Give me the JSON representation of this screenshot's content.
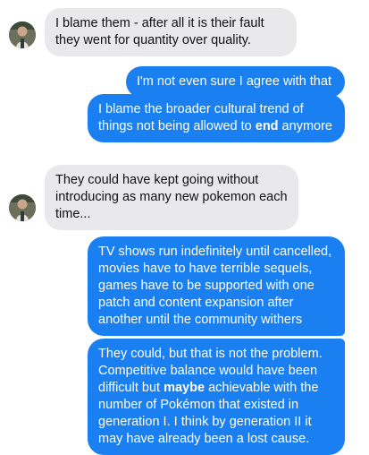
{
  "colors": {
    "incoming_bubble": "#e9e9eb",
    "outgoing_bubble": "#1a7ff0",
    "outgoing_text": "#ffffff",
    "incoming_text": "#111111"
  },
  "messages": [
    {
      "direction": "incoming",
      "avatar": "user-avatar-icon",
      "parts": [
        "I blame them - after all it is their fault they went for quantity over quality."
      ]
    },
    {
      "direction": "outgoing",
      "parts": [
        "I'm not even sure I agree with that"
      ]
    },
    {
      "direction": "outgoing",
      "parts": [
        "I blame the broader cultural trend of things not being allowed to ",
        "end",
        " anymore"
      ]
    },
    {
      "direction": "incoming",
      "avatar": "user-avatar-icon",
      "parts": [
        "They could have kept going without introducing as many new pokemon each time..."
      ]
    },
    {
      "direction": "outgoing",
      "parts": [
        "TV shows run indefinitely until cancelled, movies have to have terrible sequels, games have to be supported with one patch and content expansion after another until the community withers"
      ]
    },
    {
      "direction": "outgoing",
      "parts": [
        "They could, but that is not the problem. Competitive balance would have been difficult but ",
        "maybe",
        " achievable with the number of Pokémon that existed in generation I.  I think by generation II it may have already been a lost cause."
      ]
    }
  ]
}
